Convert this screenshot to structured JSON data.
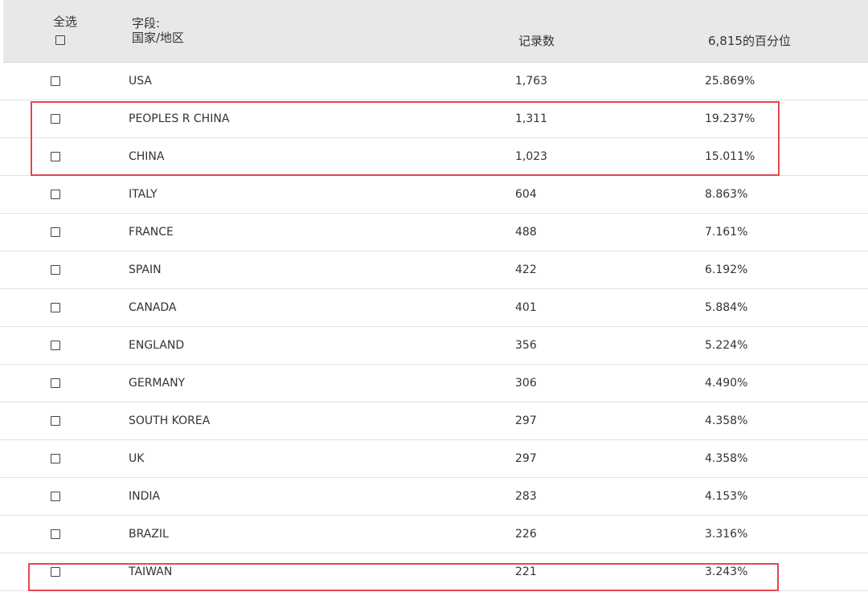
{
  "header": {
    "select_all_label": "全选",
    "field_label_line1": "字段:",
    "field_label_line2": "国家/地区",
    "count_label": "记录数",
    "pct_label": "6,815的百分位"
  },
  "rows": [
    {
      "country": "USA",
      "count": "1,763",
      "pct": "25.869%"
    },
    {
      "country": "PEOPLES R CHINA",
      "count": "1,311",
      "pct": "19.237%"
    },
    {
      "country": "CHINA",
      "count": "1,023",
      "pct": "15.011%"
    },
    {
      "country": "ITALY",
      "count": "604",
      "pct": "8.863%"
    },
    {
      "country": "FRANCE",
      "count": "488",
      "pct": "7.161%"
    },
    {
      "country": "SPAIN",
      "count": "422",
      "pct": "6.192%"
    },
    {
      "country": "CANADA",
      "count": "401",
      "pct": "5.884%"
    },
    {
      "country": "ENGLAND",
      "count": "356",
      "pct": "5.224%"
    },
    {
      "country": "GERMANY",
      "count": "306",
      "pct": "4.490%"
    },
    {
      "country": "SOUTH KOREA",
      "count": "297",
      "pct": "4.358%"
    },
    {
      "country": "UK",
      "count": "297",
      "pct": "4.358%"
    },
    {
      "country": "INDIA",
      "count": "283",
      "pct": "4.153%"
    },
    {
      "country": "BRAZIL",
      "count": "226",
      "pct": "3.316%"
    },
    {
      "country": "TAIWAN",
      "count": "221",
      "pct": "3.243%"
    }
  ],
  "colors": {
    "header_background": "#e7e8ea",
    "highlight": "#e5474f",
    "text": "#333333"
  }
}
